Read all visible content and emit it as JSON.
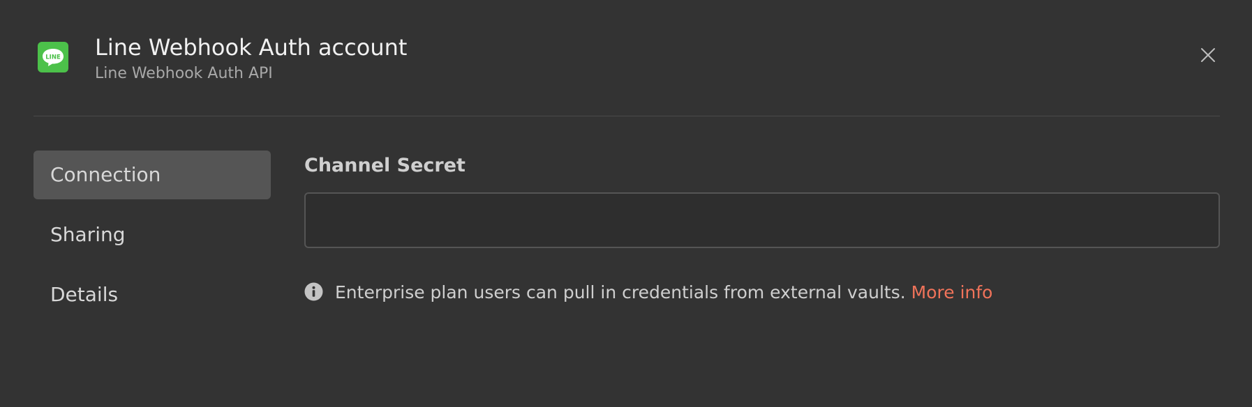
{
  "header": {
    "title": "Line Webhook Auth account",
    "subtitle": "Line Webhook Auth API",
    "logo_text": "LINE",
    "logo_color": "#4cc14a",
    "logo_icon": "line-logo-icon",
    "close_icon": "close-icon"
  },
  "sidebar": {
    "items": [
      {
        "label": "Connection",
        "active": true
      },
      {
        "label": "Sharing",
        "active": false
      },
      {
        "label": "Details",
        "active": false
      }
    ]
  },
  "connection": {
    "field_label": "Channel Secret",
    "field_value": "",
    "field_placeholder": "",
    "info_icon": "info-icon",
    "info_text": "Enterprise plan users can pull in credentials from external vaults.",
    "info_link": "More info",
    "link_color": "#f0735a"
  }
}
